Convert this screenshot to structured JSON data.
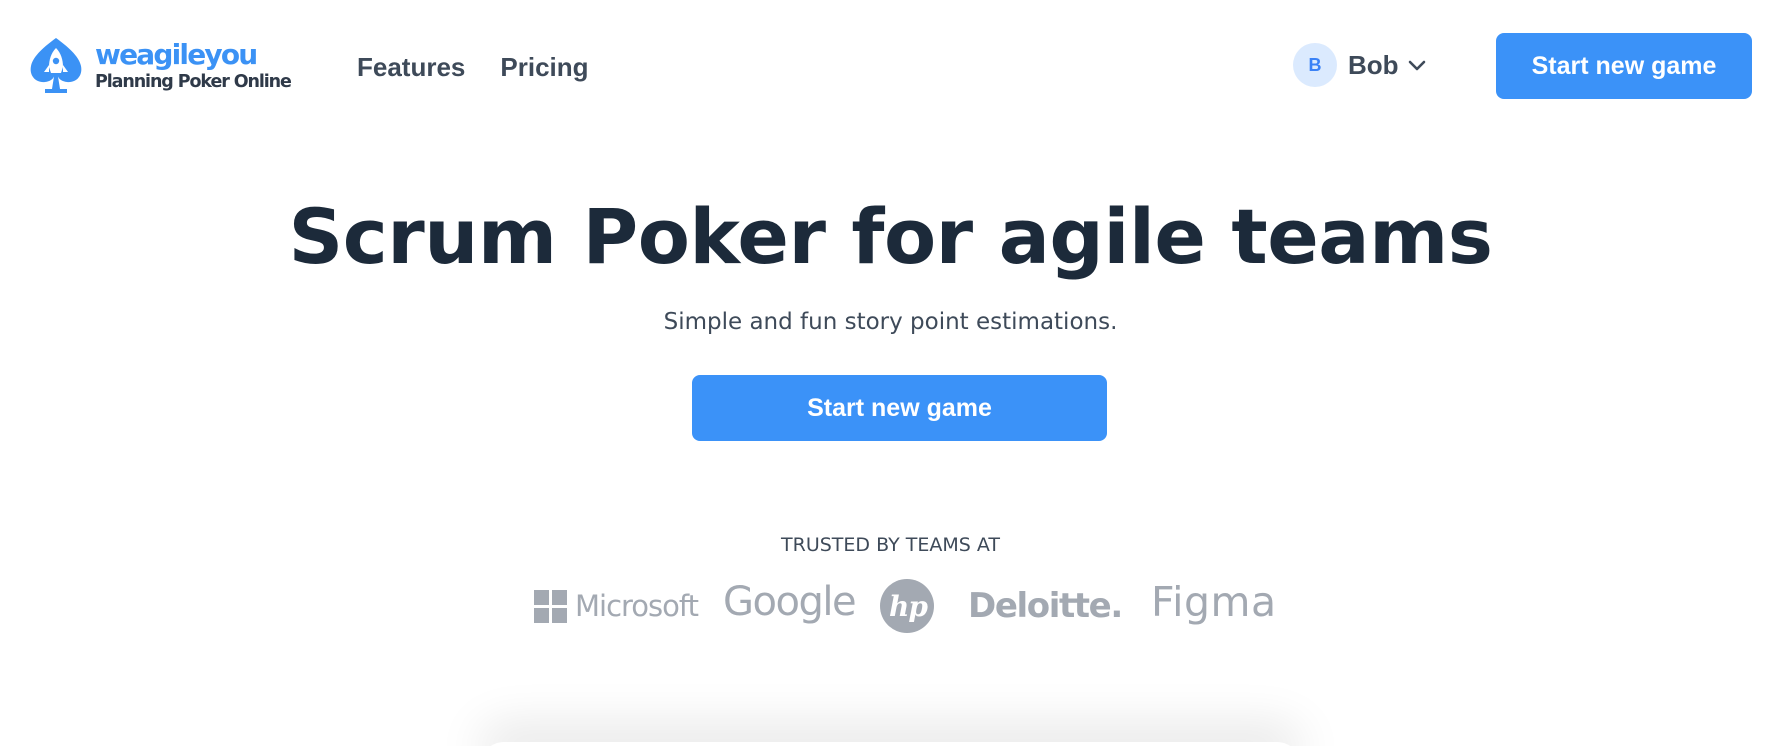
{
  "brand": {
    "name": "weagileyou",
    "tagline": "Planning Poker Online",
    "accent_color": "#3b92f8",
    "icon": "rocket-spade-icon"
  },
  "nav": {
    "items": [
      {
        "label": "Features"
      },
      {
        "label": "Pricing"
      }
    ]
  },
  "user": {
    "initial": "B",
    "name": "Bob",
    "menu_icon": "chevron-down-icon"
  },
  "header": {
    "cta_label": "Start new game"
  },
  "hero": {
    "title": "Scrum Poker for agile teams",
    "subtitle": "Simple and fun story point estimations.",
    "cta_label": "Start new game"
  },
  "trusted": {
    "label": "TRUSTED BY TEAMS AT",
    "logo_color": "#a3a9b2",
    "logos": [
      {
        "name": "Microsoft",
        "icon": "microsoft-logo"
      },
      {
        "name": "Google",
        "icon": "google-logo"
      },
      {
        "name": "hp",
        "icon": "hp-logo"
      },
      {
        "name": "Deloitte.",
        "icon": "deloitte-logo"
      },
      {
        "name": "Figma",
        "icon": "figma-logo"
      }
    ]
  }
}
